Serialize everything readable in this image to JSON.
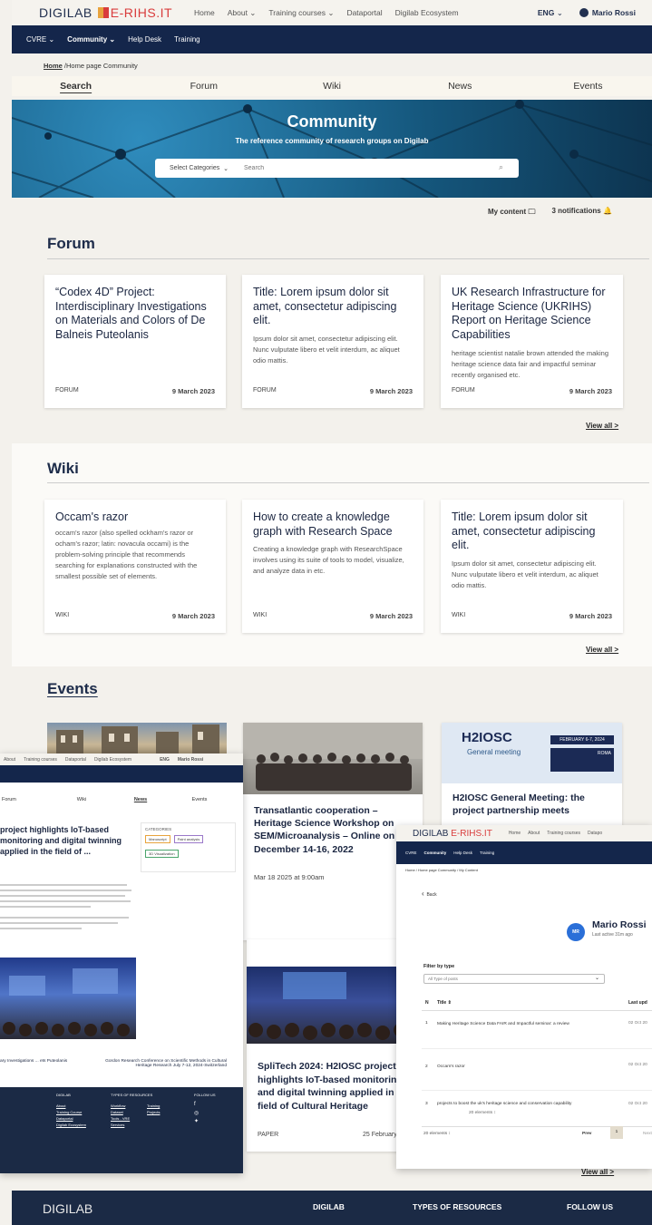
{
  "topbar": {
    "logo_a": "DIGILAB",
    "logo_b": "E-RIHS.IT",
    "nav": [
      "Home",
      "About",
      "Training courses",
      "Dataportal",
      "Digilab Ecosystem"
    ],
    "lang": "ENG",
    "user": "Mario Rossi"
  },
  "navbar": {
    "items": [
      "CVRE",
      "Community",
      "Help Desk",
      "Training"
    ]
  },
  "breadcrumb": {
    "home": "Home",
    "rest": " /Home page Community"
  },
  "tabs": [
    "Search",
    "Forum",
    "Wiki",
    "News",
    "Events"
  ],
  "hero": {
    "title": "Community",
    "subtitle": "The reference community of research groups on Digilab",
    "select": "Select Categories",
    "search_placeholder": "Search"
  },
  "toolbar": {
    "my_content": "My content",
    "notifications": "3 notifications"
  },
  "forum": {
    "title": "Forum",
    "view_all": "View all >",
    "cards": [
      {
        "title": "“Codex 4D” Project: Interdisciplinary Investigations on Materials and Colors of De Balneis Puteolanis",
        "text": "",
        "tag": "FORUM",
        "date": "9 March 2023"
      },
      {
        "title": "Title: Lorem ipsum dolor sit amet, consectetur adipiscing elit.",
        "text": "Ipsum dolor sit amet, consectetur adipiscing elit. Nunc vulputate libero et velit interdum, ac aliquet odio mattis.",
        "tag": "FORUM",
        "date": "9 March 2023"
      },
      {
        "title": "UK Research Infrastructure for Heritage Science (UKRIHS) Report on Heritage Science Capabilities",
        "text": "heritage scientist natalie brown attended the making heritage science data fair and impactful seminar recently organised etc.",
        "tag": "FORUM",
        "date": "9 March 2023"
      }
    ]
  },
  "wiki": {
    "title": "Wiki",
    "view_all": "View all >",
    "cards": [
      {
        "title": "Occam's razor",
        "text": "occam's razor (also spelled ockham's razor or ocham's razor; latin: novacula occami) is the problem-solving principle that recommends searching for explanations constructed with the smallest possible set of elements.",
        "tag": "WIKI",
        "date": "9 March 2023"
      },
      {
        "title": "How to create a knowledge graph with Research Space",
        "text": "Creating a knowledge graph with ResearchSpace involves using its suite of tools to model, visualize, and analyze data in etc.",
        "tag": "WIKI",
        "date": "9 March 2023"
      },
      {
        "title": "Title: Lorem ipsum dolor sit amet, consectetur adipiscing elit.",
        "text": "Ipsum dolor sit amet, consectetur adipiscing elit. Nunc vulputate libero et velit interdum, ac aliquet odio mattis.",
        "tag": "WIKI",
        "date": "9 March 2023"
      }
    ]
  },
  "events": {
    "title": "Events",
    "view_all": "View all >",
    "card2": {
      "title": "Transatlantic cooperation – Heritage Science Workshop on SEM/Microanalysis – Online on December 14-16, 2022",
      "date": "Mar 18 2025 at 9:00am"
    },
    "card3": {
      "title": "H2IOSC General Meeting: the project partnership meets",
      "banner": "H2IOSC",
      "banner_sub": "General meeting",
      "banner_date": "FEBRUARY 6-7, 2024",
      "banner_city": "ROMA"
    },
    "card4": {
      "title": "SpliTech 2024: H2IOSC project highlights IoT-based monitoring and digital twinning applied in the field of Cultural Heritage",
      "tag": "PAPER",
      "date": "25 February"
    }
  },
  "news_overlay": {
    "nav": [
      "Home",
      "About",
      "Training courses",
      "Dataportal",
      "Digilab Ecosystem"
    ],
    "lang": "ENG",
    "user": "Mario Rossi",
    "tabs": [
      "Forum",
      "Wiki",
      "News",
      "Events"
    ],
    "title": "project highlights IoT-based monitoring and digital twinning applied in the field of ...",
    "categories_title": "CATEGORIES",
    "categories": [
      "Manuscript",
      "Paint analysis",
      "3D Visualization"
    ],
    "prev": "ary Investigations ... ets Puteolanis",
    "next": "Gordon Research Conference on Scientific Methods in Cultural Heritage Research July 7-12, 2024-Switzerland",
    "footer_cols": [
      "DIGILAB",
      "TYPES OF RESOURCES",
      "FOLLOW US"
    ],
    "footer_links": [
      "About",
      "Training Course",
      "Dataportal",
      "Digilab Ecosystem",
      "Workflow",
      "Dataset",
      "Tools - VRE",
      "Services",
      "Training",
      "Projects"
    ]
  },
  "mycontent_overlay": {
    "logo_a": "DIGILAB",
    "logo_b": "E-RIHS.IT",
    "nav": [
      "Home",
      "About",
      "Training courses",
      "Datapo"
    ],
    "navbar": [
      "CVRE",
      "Community",
      "Help Desk",
      "Training"
    ],
    "breadcrumb": "Home / Home page Community / My Content",
    "back": "Back",
    "avatar": "MR",
    "user": "Mario Rossi",
    "last_active": "Last active 31m ago",
    "filter_label": "Filter by type",
    "filter_value": "All Type of posts",
    "col_n": "N",
    "col_title": "Title",
    "col_last": "Last upd",
    "rows": [
      {
        "n": "1",
        "title": "Making Heritage Science Data FAIR and Impactful seminar: a review",
        "date": "02 Oct 20"
      },
      {
        "n": "2",
        "title": "Occam's razor",
        "date": "02 Oct 20"
      },
      {
        "n": "3",
        "title": "projects to boost the uk's heritage science and conservation capability",
        "sub": "20 elements",
        "date": "02 Oct 20"
      }
    ],
    "elements": "20 elements",
    "prev": "Prev",
    "page": "1",
    "next": "Next"
  },
  "footer": {
    "logo": "DIGILAB",
    "cols": [
      "DIGILAB",
      "TYPES OF RESOURCES",
      "FOLLOW US"
    ]
  }
}
